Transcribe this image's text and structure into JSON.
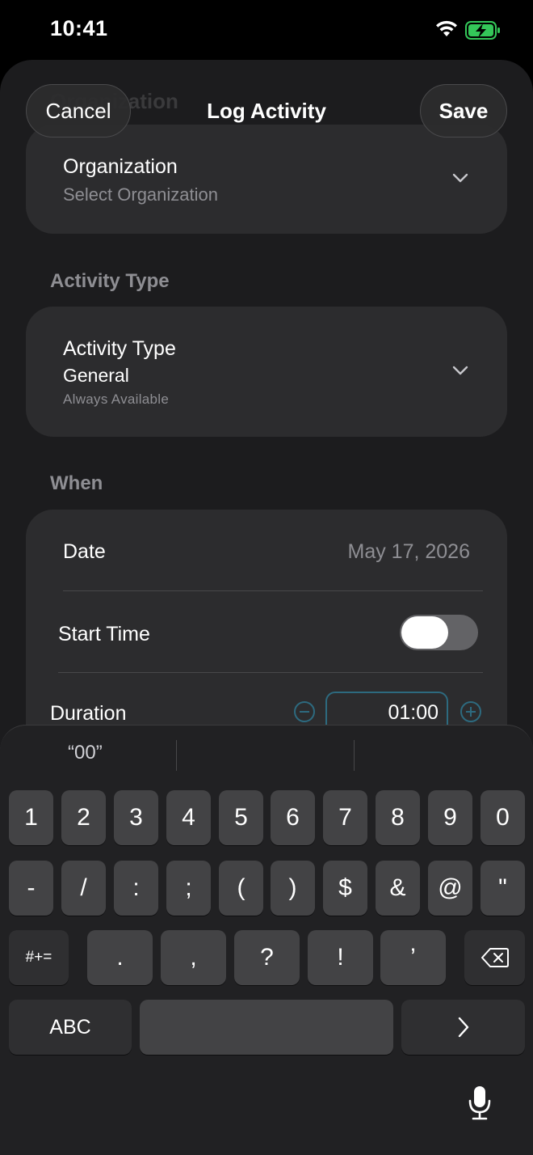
{
  "status_bar": {
    "time": "10:41"
  },
  "nav": {
    "cancel_label": "Cancel",
    "title": "Log Activity",
    "save_label": "Save",
    "ghost_title": "Organization"
  },
  "organization": {
    "label": "Organization",
    "placeholder": "Select Organization"
  },
  "activity_section": {
    "header": "Activity Type"
  },
  "activity": {
    "label": "Activity Type",
    "value": "General",
    "note": "Always Available"
  },
  "when_section": {
    "header": "When"
  },
  "when": {
    "date_label": "Date",
    "date_value": "May 17, 2026",
    "start_time_label": "Start Time",
    "start_time_enabled": false,
    "duration_label": "Duration",
    "duration_value": "01:00"
  },
  "keyboard": {
    "suggestions": [
      "“00”",
      "",
      ""
    ],
    "row1": [
      "1",
      "2",
      "3",
      "4",
      "5",
      "6",
      "7",
      "8",
      "9",
      "0"
    ],
    "row2": [
      "-",
      "/",
      ":",
      ";",
      "(",
      ")",
      "$",
      "&",
      "@",
      "\""
    ],
    "row3_shift": "#+=",
    "row3": [
      ".",
      ",",
      "?",
      "!",
      "’"
    ],
    "abc_label": "ABC",
    "return_icon": "chevron-right-icon",
    "delete_icon": "delete-backward-icon",
    "mic_icon": "microphone-icon"
  },
  "colors": {
    "background": "#1c1c1e",
    "card": "#2c2c2e",
    "secondary_text": "#8e8e93",
    "field_border": "#2d6a7f",
    "stepper_accent": "#2d6a7f",
    "battery_green": "#34c759"
  }
}
